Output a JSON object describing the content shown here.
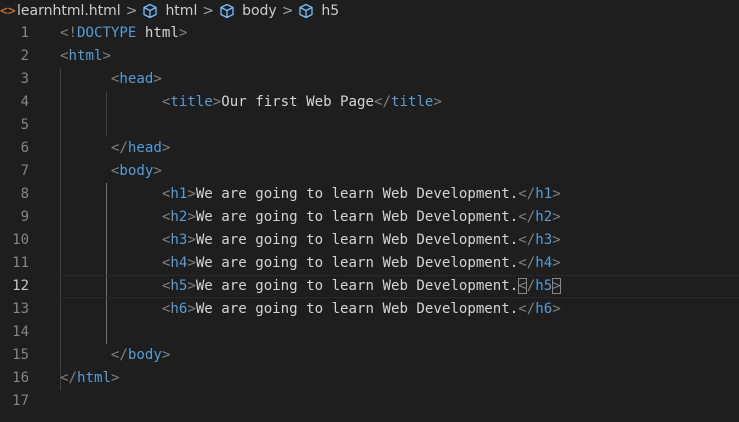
{
  "breadcrumb": {
    "file_icon": "<>",
    "file": "learnhtml.html",
    "separator": ">",
    "segments": [
      "html",
      "body",
      "h5"
    ]
  },
  "colors": {
    "background": "#1e1e1e",
    "tag": "#569cd6",
    "punctuation": "#808080",
    "text": "#d4d4d4",
    "line_number": "#858585",
    "file_icon": "#e37933"
  },
  "editor": {
    "current_line": 12,
    "lines": [
      {
        "n": "1",
        "code": [
          [
            "p",
            "<!"
          ],
          [
            "t",
            "DOCTYPE "
          ],
          [
            "x",
            "html"
          ],
          [
            "p",
            ">"
          ]
        ]
      },
      {
        "n": "2",
        "code": [
          [
            "p",
            "<"
          ],
          [
            "t",
            "html"
          ],
          [
            "p",
            ">"
          ]
        ]
      },
      {
        "n": "3",
        "code": [
          [
            "x",
            "      "
          ],
          [
            "p",
            "<"
          ],
          [
            "t",
            "head"
          ],
          [
            "p",
            ">"
          ]
        ]
      },
      {
        "n": "4",
        "code": [
          [
            "x",
            "            "
          ],
          [
            "p",
            "<"
          ],
          [
            "t",
            "title"
          ],
          [
            "p",
            ">"
          ],
          [
            "x",
            "Our first Web Page"
          ],
          [
            "p",
            "</"
          ],
          [
            "t",
            "title"
          ],
          [
            "p",
            ">"
          ]
        ]
      },
      {
        "n": "5",
        "code": []
      },
      {
        "n": "6",
        "code": [
          [
            "x",
            "      "
          ],
          [
            "p",
            "</"
          ],
          [
            "t",
            "head"
          ],
          [
            "p",
            ">"
          ]
        ]
      },
      {
        "n": "7",
        "code": [
          [
            "x",
            "      "
          ],
          [
            "p",
            "<"
          ],
          [
            "t",
            "body"
          ],
          [
            "p",
            ">"
          ]
        ]
      },
      {
        "n": "8",
        "code": [
          [
            "x",
            "            "
          ],
          [
            "p",
            "<"
          ],
          [
            "t",
            "h1"
          ],
          [
            "p",
            ">"
          ],
          [
            "x",
            "We are going to learn Web Development."
          ],
          [
            "p",
            "</"
          ],
          [
            "t",
            "h1"
          ],
          [
            "p",
            ">"
          ]
        ]
      },
      {
        "n": "9",
        "code": [
          [
            "x",
            "            "
          ],
          [
            "p",
            "<"
          ],
          [
            "t",
            "h2"
          ],
          [
            "p",
            ">"
          ],
          [
            "x",
            "We are going to learn Web Development."
          ],
          [
            "p",
            "</"
          ],
          [
            "t",
            "h2"
          ],
          [
            "p",
            ">"
          ]
        ]
      },
      {
        "n": "10",
        "code": [
          [
            "x",
            "            "
          ],
          [
            "p",
            "<"
          ],
          [
            "t",
            "h3"
          ],
          [
            "p",
            ">"
          ],
          [
            "x",
            "We are going to learn Web Development."
          ],
          [
            "p",
            "</"
          ],
          [
            "t",
            "h3"
          ],
          [
            "p",
            ">"
          ]
        ]
      },
      {
        "n": "11",
        "code": [
          [
            "x",
            "            "
          ],
          [
            "p",
            "<"
          ],
          [
            "t",
            "h4"
          ],
          [
            "p",
            ">"
          ],
          [
            "x",
            "We are going to learn Web Development."
          ],
          [
            "p",
            "</"
          ],
          [
            "t",
            "h4"
          ],
          [
            "p",
            ">"
          ]
        ]
      },
      {
        "n": "12",
        "code": [
          [
            "x",
            "            "
          ],
          [
            "p",
            "<"
          ],
          [
            "t",
            "h5"
          ],
          [
            "p",
            ">"
          ],
          [
            "x",
            "We are going to learn Web Development."
          ],
          [
            "pb",
            "<"
          ],
          [
            "p",
            "/"
          ],
          [
            "t",
            "h5"
          ],
          [
            "pb",
            ">"
          ]
        ]
      },
      {
        "n": "13",
        "code": [
          [
            "x",
            "            "
          ],
          [
            "p",
            "<"
          ],
          [
            "t",
            "h6"
          ],
          [
            "p",
            ">"
          ],
          [
            "x",
            "We are going to learn Web Development."
          ],
          [
            "p",
            "</"
          ],
          [
            "t",
            "h6"
          ],
          [
            "p",
            ">"
          ]
        ]
      },
      {
        "n": "14",
        "code": []
      },
      {
        "n": "15",
        "code": [
          [
            "x",
            "      "
          ],
          [
            "p",
            "</"
          ],
          [
            "t",
            "body"
          ],
          [
            "p",
            ">"
          ]
        ]
      },
      {
        "n": "16",
        "code": [
          [
            "p",
            "</"
          ],
          [
            "t",
            "html"
          ],
          [
            "p",
            ">"
          ]
        ]
      },
      {
        "n": "17",
        "code": []
      }
    ]
  }
}
